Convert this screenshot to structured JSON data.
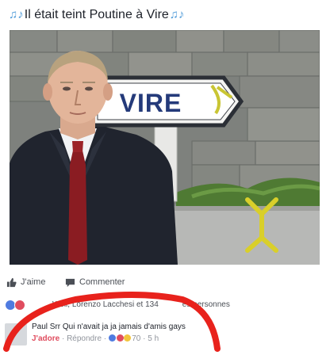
{
  "post": {
    "caption": "Il était teint Poutine à Vire",
    "caption_icon": "music-notes-icon"
  },
  "photo": {
    "sign_text": "VIRE"
  },
  "actions": {
    "like_label": "J'aime",
    "comment_label": "Commenter"
  },
  "reactions": {
    "text": "Weil, Lorenzo Lacchesi et 134",
    "text_end": "es personnes",
    "icons": [
      "like-reaction-icon",
      "love-reaction-icon"
    ]
  },
  "comment": {
    "author_text": "Paul Srr Qui n'avait ja ja jamais d'amis gays",
    "love_label": "J'adore",
    "separator": "·",
    "reply_label": "Répondre",
    "reaction_count": "70",
    "time": "5 h"
  },
  "colors": {
    "accent": "#4f9bd9",
    "love": "#e04d5f",
    "annotation": "#e8221c"
  }
}
